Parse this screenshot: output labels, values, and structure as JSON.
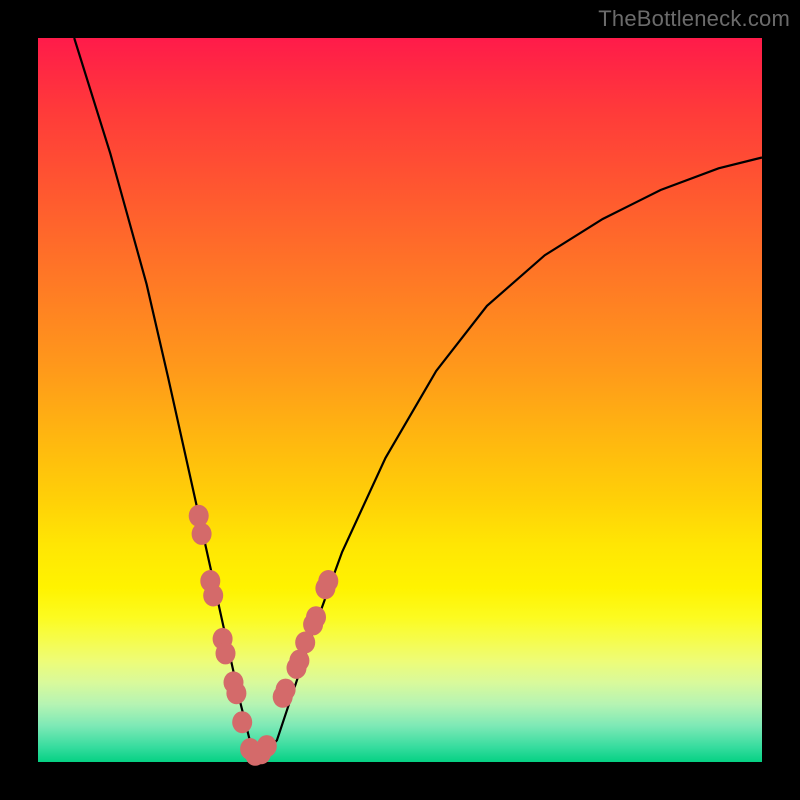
{
  "watermark": "TheBottleneck.com",
  "colors": {
    "frame": "#000000",
    "curve": "#000000",
    "marker_fill": "#d46a6a",
    "marker_stroke": "#c25757"
  },
  "chart_data": {
    "type": "line",
    "title": "",
    "xlabel": "",
    "ylabel": "",
    "xlim": [
      0,
      100
    ],
    "ylim": [
      0,
      100
    ],
    "series": [
      {
        "name": "bottleneck-curve",
        "x": [
          5,
          10,
          15,
          18,
          20,
          22,
          24,
          26,
          28,
          29.5,
          31,
          33,
          35,
          38,
          42,
          48,
          55,
          62,
          70,
          78,
          86,
          94,
          100
        ],
        "y": [
          100,
          84,
          66,
          53,
          44,
          35,
          26,
          17,
          8,
          2,
          1,
          3,
          9,
          18,
          29,
          42,
          54,
          63,
          70,
          75,
          79,
          82,
          83.5
        ]
      }
    ],
    "markers": {
      "name": "highlight-points",
      "x": [
        22.2,
        22.6,
        23.8,
        24.2,
        25.5,
        25.9,
        27.0,
        27.4,
        28.2,
        29.3,
        30.0,
        30.8,
        31.6,
        33.8,
        34.2,
        35.7,
        36.1,
        36.9,
        38.0,
        38.4,
        39.7,
        40.1
      ],
      "y": [
        34.0,
        31.5,
        25.0,
        23.0,
        17.0,
        15.0,
        11.0,
        9.5,
        5.5,
        1.8,
        1.0,
        1.2,
        2.2,
        9.0,
        10.0,
        13.0,
        14.0,
        16.5,
        19.0,
        20.0,
        24.0,
        25.0
      ]
    }
  }
}
